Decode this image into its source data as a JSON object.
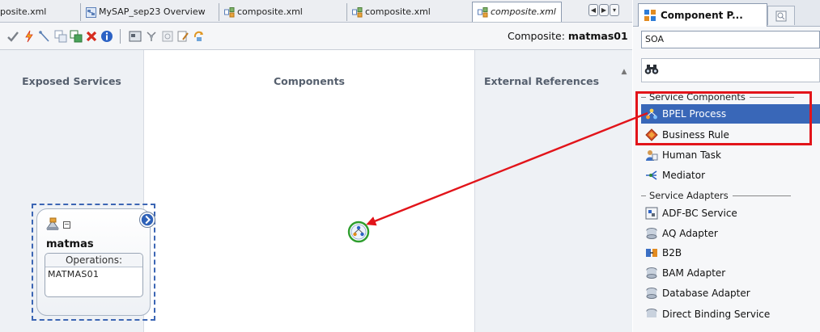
{
  "editor": {
    "tabs": [
      {
        "label": "posite.xml",
        "icon": "none"
      },
      {
        "label": "MySAP_sep23 Overview",
        "icon": "overview-icon"
      },
      {
        "label": "composite.xml",
        "icon": "composite-icon"
      },
      {
        "label": "composite.xml",
        "icon": "composite-icon"
      },
      {
        "label": "composite.xml",
        "icon": "composite-icon",
        "active": true
      }
    ],
    "composite_prefix": "Composite:",
    "composite_name": "matmas01",
    "toolbar_icons": [
      "validate-icon",
      "deploy-icon",
      "wire-icon",
      "copy-icon",
      "paste-icon",
      "delete-icon",
      "info-icon",
      "layout-icon",
      "layout-grid-icon",
      "view-icon",
      "edit-icon",
      "refresh-icon"
    ]
  },
  "lanes": {
    "exposed_services": "Exposed Services",
    "components": "Components",
    "external_references": "External References"
  },
  "service": {
    "name": "matmas",
    "operations_label": "Operations:",
    "operation": "MATMAS01"
  },
  "palette": {
    "title": "Component P...",
    "category": "SOA",
    "groups": {
      "service_components": "Service Components",
      "service_adapters": "Service Adapters"
    },
    "components": [
      {
        "label": "BPEL Process",
        "icon": "bpel-icon",
        "selected": true
      },
      {
        "label": "Business Rule",
        "icon": "business-rule-icon"
      },
      {
        "label": "Human Task",
        "icon": "human-task-icon"
      },
      {
        "label": "Mediator",
        "icon": "mediator-icon"
      }
    ],
    "adapters": [
      {
        "label": "ADF-BC Service",
        "icon": "adf-bc-icon"
      },
      {
        "label": "AQ Adapter",
        "icon": "aq-adapter-icon"
      },
      {
        "label": "B2B",
        "icon": "b2b-icon"
      },
      {
        "label": "BAM Adapter",
        "icon": "bam-adapter-icon"
      },
      {
        "label": "Database Adapter",
        "icon": "database-adapter-icon"
      },
      {
        "label": "Direct Binding Service",
        "icon": "direct-binding-icon"
      }
    ]
  },
  "annotation": {
    "highlight_color": "#e2141a",
    "drop_ring_color": "#2e9e2e"
  },
  "colors": {
    "selection": "#3967b8",
    "lane_bg": "#eef1f5",
    "dashed_select": "#3c66b4"
  }
}
